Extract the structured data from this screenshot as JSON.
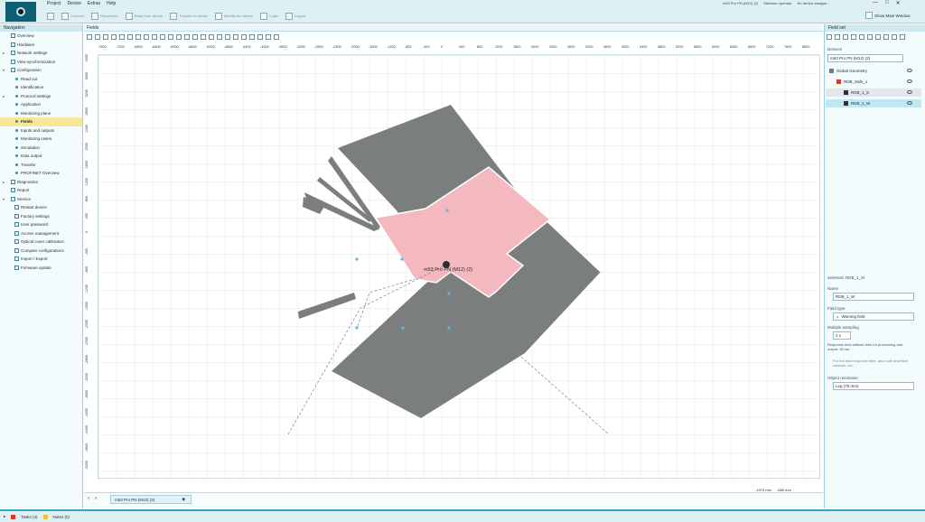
{
  "menu": [
    "Project",
    "Device",
    "Extras",
    "Help"
  ],
  "window_title": "m53 Pro PN (M12) (2)",
  "window_status": [
    "Machine operator",
    "No device assigne..."
  ],
  "window_controls": [
    "—",
    "□",
    "✕"
  ],
  "ribbon": [
    {
      "label": "Connect",
      "active": false
    },
    {
      "label": "Disconnect",
      "active": false
    },
    {
      "label": "Read from device",
      "active": false
    },
    {
      "label": "Transfer to device",
      "active": false
    },
    {
      "label": "Identify the device",
      "active": false
    },
    {
      "label": "Login",
      "active": false
    },
    {
      "label": "Logout",
      "active": false
    }
  ],
  "show_main_window": "Show Main Window",
  "nav": {
    "title": "Navigation",
    "items": [
      {
        "label": "Overview",
        "kind": "icon",
        "indent": 1
      },
      {
        "label": "Hardware",
        "kind": "icon",
        "indent": 1
      },
      {
        "label": "Network settings",
        "kind": "icon",
        "indent": 1,
        "expandable": true
      },
      {
        "label": "View synchronization",
        "kind": "icon",
        "indent": 1
      },
      {
        "label": "Configuration",
        "kind": "icon",
        "indent": 1,
        "expanded": true
      },
      {
        "label": "Read out",
        "kind": "bullet",
        "indent": 2
      },
      {
        "label": "Identification",
        "kind": "bullet",
        "indent": 2
      },
      {
        "label": "Protocol settings",
        "kind": "bullet",
        "indent": 2,
        "expandable": true
      },
      {
        "label": "Application",
        "kind": "bullet",
        "indent": 2
      },
      {
        "label": "Monitoring plane",
        "kind": "bullet",
        "indent": 2
      },
      {
        "label": "Fields",
        "kind": "bullet",
        "indent": 2,
        "selected": true
      },
      {
        "label": "Inputs and outputs",
        "kind": "bullet",
        "indent": 2
      },
      {
        "label": "Monitoring cases",
        "kind": "bullet",
        "indent": 2
      },
      {
        "label": "Simulation",
        "kind": "bullet",
        "indent": 2
      },
      {
        "label": "Data output",
        "kind": "bullet",
        "indent": 2
      },
      {
        "label": "Transfer",
        "kind": "bullet",
        "indent": 2
      },
      {
        "label": "PROFINET Overview",
        "kind": "bullet",
        "indent": 2
      },
      {
        "label": "Diagnostics",
        "kind": "icon",
        "indent": 1,
        "expandable": true
      },
      {
        "label": "Report",
        "kind": "icon",
        "indent": 1
      },
      {
        "label": "Service",
        "kind": "icon",
        "indent": 1,
        "expanded": true
      },
      {
        "label": "Restart device",
        "kind": "icon",
        "indent": 2
      },
      {
        "label": "Factory settings",
        "kind": "icon",
        "indent": 2
      },
      {
        "label": "User password",
        "kind": "icon",
        "indent": 2
      },
      {
        "label": "Access management",
        "kind": "icon",
        "indent": 2
      },
      {
        "label": "Optical cover calibration",
        "kind": "icon",
        "indent": 2
      },
      {
        "label": "Compare configurations",
        "kind": "icon",
        "indent": 2
      },
      {
        "label": "Import / Export",
        "kind": "icon",
        "indent": 2
      },
      {
        "label": "Firmware update",
        "kind": "icon",
        "indent": 2
      }
    ]
  },
  "fields": {
    "title": "Fields",
    "device_label": "m53 Pro PN (M12) (2)",
    "tab_label": "m53 Pro PN (M12) (2)",
    "h_ticks": [
      "-7600",
      "-7200",
      "-6800",
      "-6400",
      "-6000",
      "-5600",
      "-5200",
      "-4800",
      "-4400",
      "-4000",
      "-3600",
      "-3200",
      "-2800",
      "-2400",
      "-2000",
      "-1600",
      "-1200",
      "-800",
      "-400",
      "0",
      "400",
      "800",
      "1200",
      "1600",
      "2000",
      "2400",
      "2800",
      "3200",
      "3600",
      "4000",
      "4400",
      "4800",
      "5200",
      "5600",
      "6000",
      "6400",
      "6800",
      "7200",
      "7600",
      "8000"
    ],
    "v_ticks": [
      "4000",
      "3600",
      "3200",
      "2800",
      "2400",
      "2000",
      "1600",
      "1200",
      "800",
      "400",
      "0",
      "-400",
      "-800",
      "-1200",
      "-1600",
      "-2000",
      "-2400",
      "-2800",
      "-3200",
      "-3600",
      "-4000",
      "-4400",
      "-4800",
      "-5200"
    ],
    "coord_x": "-1973 mm",
    "coord_y": "-680 mm"
  },
  "fieldset": {
    "title": "Field set",
    "devices_label": "Devices",
    "device_value": "m53 Pro PN (M12) (2)",
    "tree": [
      {
        "label": "Global Geometry",
        "level": 0
      },
      {
        "label": "RDB_Safe_1",
        "level": 1
      },
      {
        "label": "RDB_1_S",
        "level": 2
      },
      {
        "label": "RDB_1_W",
        "level": 2,
        "selected": true
      }
    ],
    "selected_label": "Selected: RDB_1_W",
    "name_label": "Name",
    "name_value": "RDB_1_W",
    "fieldtype_label": "Field type",
    "fieldtype_value": "Warning field",
    "sampling_label": "Multiple sampling",
    "sampling_value": "2 x",
    "response_note": "Response time without time for processing and output: 30 ms",
    "info_note": "For the total response time, also note downline controls, etc.",
    "resolution_label": "Object resolution",
    "resolution_value": "Leg (70 mm)"
  },
  "status": {
    "tasks": "Tasks (4)",
    "notes": "Notes (0)"
  },
  "colors": {
    "accent": "#2aa8c4",
    "protective_field": "#f4b9bf",
    "warning_field": "#7a7f7e",
    "selection": "#f6e79a"
  }
}
